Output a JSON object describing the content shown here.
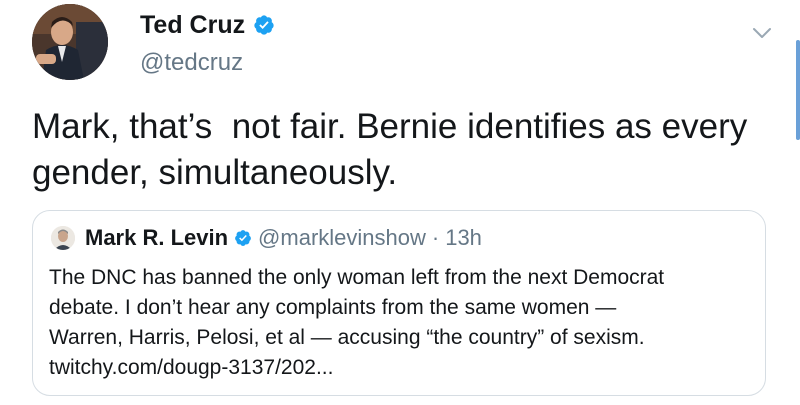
{
  "tweet": {
    "author": {
      "name": "Ted Cruz",
      "handle": "@tedcruz",
      "verified": true
    },
    "text": "Mark, that’s  not fair. Bernie identifies as every gender, simultaneously.",
    "menu_icon": "chevron-down-icon"
  },
  "quote": {
    "author": {
      "name": "Mark R. Levin",
      "handle": "@marklevinshow",
      "verified": true
    },
    "separator": "·",
    "time": "13h",
    "text_lines": [
      "The DNC has banned the only woman left from the next Democrat",
      "debate.  I don’t hear any complaints from the same women —",
      "Warren, Harris, Pelosi, et al — accusing “the country” of sexism.",
      "twitchy.com/dougp-3137/202..."
    ]
  },
  "colors": {
    "text": "#14171a",
    "secondary": "#657786",
    "verified": "#1da1f2",
    "border": "#d6dde3"
  }
}
